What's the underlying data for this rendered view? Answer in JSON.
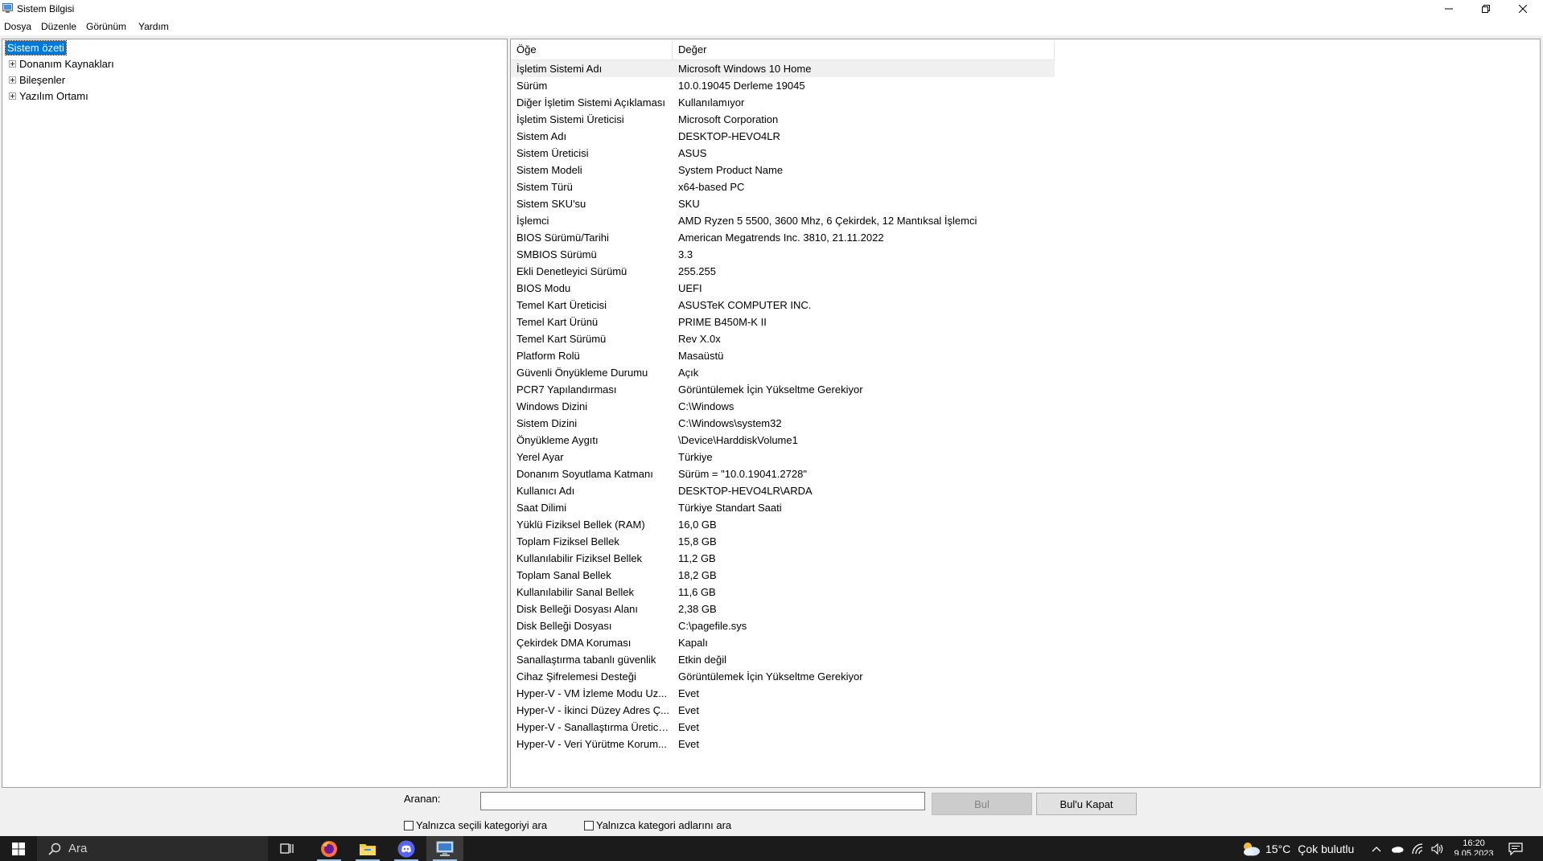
{
  "window": {
    "title": "Sistem Bilgisi"
  },
  "menu": [
    "Dosya",
    "Düzenle",
    "Görünüm",
    "Yardım"
  ],
  "tree": {
    "selected": "Sistem özeti",
    "children": [
      "Donanım Kaynakları",
      "Bileşenler",
      "Yazılım Ortamı"
    ]
  },
  "list": {
    "columns": [
      "Öğe",
      "Değer"
    ],
    "rows": [
      {
        "item": "İşletim Sistemi Adı",
        "value": "Microsoft Windows 10 Home"
      },
      {
        "item": "Sürüm",
        "value": "10.0.19045 Derleme 19045"
      },
      {
        "item": "Diğer İşletim Sistemi Açıklaması",
        "value": "Kullanılamıyor"
      },
      {
        "item": "İşletim Sistemi Üreticisi",
        "value": "Microsoft Corporation"
      },
      {
        "item": "Sistem Adı",
        "value": "DESKTOP-HEVO4LR"
      },
      {
        "item": "Sistem Üreticisi",
        "value": "ASUS"
      },
      {
        "item": "Sistem Modeli",
        "value": "System Product Name"
      },
      {
        "item": "Sistem Türü",
        "value": "x64-based PC"
      },
      {
        "item": "Sistem SKU'su",
        "value": "SKU"
      },
      {
        "item": "İşlemci",
        "value": "AMD Ryzen 5 5500, 3600 Mhz, 6 Çekirdek, 12 Mantıksal İşlemci"
      },
      {
        "item": "BIOS Sürümü/Tarihi",
        "value": "American Megatrends Inc. 3810, 21.11.2022"
      },
      {
        "item": "SMBIOS Sürümü",
        "value": "3.3"
      },
      {
        "item": "Ekli Denetleyici Sürümü",
        "value": "255.255"
      },
      {
        "item": "BIOS Modu",
        "value": "UEFI"
      },
      {
        "item": "Temel Kart Üreticisi",
        "value": "ASUSTeK COMPUTER INC."
      },
      {
        "item": "Temel Kart Ürünü",
        "value": "PRIME B450M-K II"
      },
      {
        "item": "Temel Kart Sürümü",
        "value": "Rev X.0x"
      },
      {
        "item": "Platform Rolü",
        "value": "Masaüstü"
      },
      {
        "item": "Güvenli Önyükleme Durumu",
        "value": "Açık"
      },
      {
        "item": "PCR7 Yapılandırması",
        "value": "Görüntülemek İçin Yükseltme Gerekiyor"
      },
      {
        "item": "Windows Dizini",
        "value": "C:\\Windows"
      },
      {
        "item": "Sistem Dizini",
        "value": "C:\\Windows\\system32"
      },
      {
        "item": "Önyükleme Aygıtı",
        "value": "\\Device\\HarddiskVolume1"
      },
      {
        "item": "Yerel Ayar",
        "value": "Türkiye"
      },
      {
        "item": "Donanım Soyutlama Katmanı",
        "value": "Sürüm = \"10.0.19041.2728\""
      },
      {
        "item": "Kullanıcı Adı",
        "value": "DESKTOP-HEVO4LR\\ARDA"
      },
      {
        "item": "Saat Dilimi",
        "value": "Türkiye Standart Saati"
      },
      {
        "item": "Yüklü Fiziksel Bellek (RAM)",
        "value": "16,0 GB"
      },
      {
        "item": "Toplam Fiziksel Bellek",
        "value": "15,8 GB"
      },
      {
        "item": "Kullanılabilir Fiziksel Bellek",
        "value": "11,2 GB"
      },
      {
        "item": "Toplam Sanal Bellek",
        "value": "18,2 GB"
      },
      {
        "item": "Kullanılabilir Sanal Bellek",
        "value": "11,6 GB"
      },
      {
        "item": "Disk Belleği Dosyası Alanı",
        "value": "2,38 GB"
      },
      {
        "item": "Disk Belleği Dosyası",
        "value": "C:\\pagefile.sys"
      },
      {
        "item": "Çekirdek DMA Koruması",
        "value": "Kapalı"
      },
      {
        "item": "Sanallaştırma tabanlı güvenlik",
        "value": "Etkin değil"
      },
      {
        "item": "Cihaz Şifrelemesi Desteği",
        "value": "Görüntülemek İçin Yükseltme Gerekiyor"
      },
      {
        "item": "Hyper-V - VM İzleme Modu Uz...",
        "value": "Evet"
      },
      {
        "item": "Hyper-V - İkinci Düzey Adres Ç...",
        "value": "Evet"
      },
      {
        "item": "Hyper-V - Sanallaştırma Üretici ...",
        "value": "Evet"
      },
      {
        "item": "Hyper-V - Veri Yürütme Korum...",
        "value": "Evet"
      }
    ]
  },
  "search": {
    "label": "Aranan:",
    "value": "",
    "find_button": "Bul",
    "close_button": "Bul'u Kapat",
    "option_selected_category": "Yalnızca seçili kategoriyi ara",
    "option_category_names": "Yalnızca kategori adlarını ara"
  },
  "taskbar": {
    "search_placeholder": "Ara",
    "apps": [
      "task-view-icon",
      "firefox-icon",
      "file-explorer-icon",
      "discord-icon",
      "system-information-icon"
    ],
    "weather_temp": "15°C",
    "weather_text": "Çok bulutlu",
    "time": "16:20",
    "date": "9.05.2023"
  },
  "colors": {
    "selection": "#0078d7",
    "taskbar": "#1b1b1b"
  }
}
